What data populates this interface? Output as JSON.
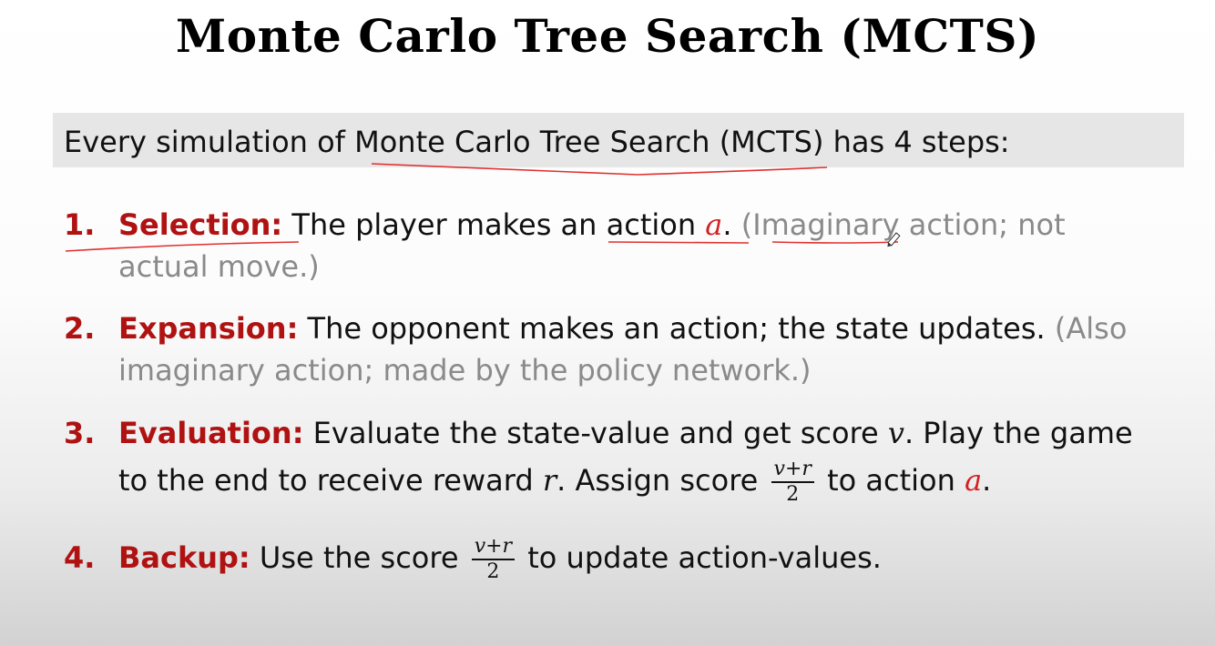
{
  "title": "Monte Carlo Tree Search (MCTS)",
  "intro": {
    "before": "Every simulation of ",
    "highlight": "Monte Carlo Tree Search (MCTS)",
    "after": " has 4 steps:"
  },
  "steps": [
    {
      "number": "1.",
      "keyword": "Selection:",
      "text_a": " The player makes an ",
      "underlined": "action",
      "var": "a",
      "dot": ".",
      "note_open": " (",
      "note_underlined": "Imaginary",
      "note_rest": " action; not",
      "note_line2": "actual move.)"
    },
    {
      "number": "2.",
      "keyword": "Expansion:",
      "text": " The opponent makes an action; the state updates. ",
      "note_start": "(Also",
      "note_line2": "imaginary action; made by the policy network.)"
    },
    {
      "number": "3.",
      "keyword": "Evaluation:",
      "text_a": " Evaluate the state-value and get score ",
      "var_v": "v",
      "text_b": ". Play the game",
      "line2_a": "to the end to receive reward ",
      "var_r": "r",
      "line2_b": ". Assign score ",
      "frac_num": "v+r",
      "frac_den": "2",
      "line2_c": " to action ",
      "var_a": "a",
      "line2_d": "."
    },
    {
      "number": "4.",
      "keyword": "Backup:",
      "text_a": " Use the score ",
      "frac_num": "v+r",
      "frac_den": "2",
      "text_b": " to update action-values."
    }
  ],
  "colors": {
    "keyword": "#b01212",
    "variable_a": "#d32020",
    "note_gray": "#8a8a8a",
    "annotation_pen": "#e0302e",
    "banner_bg": "#e6e6e6"
  }
}
